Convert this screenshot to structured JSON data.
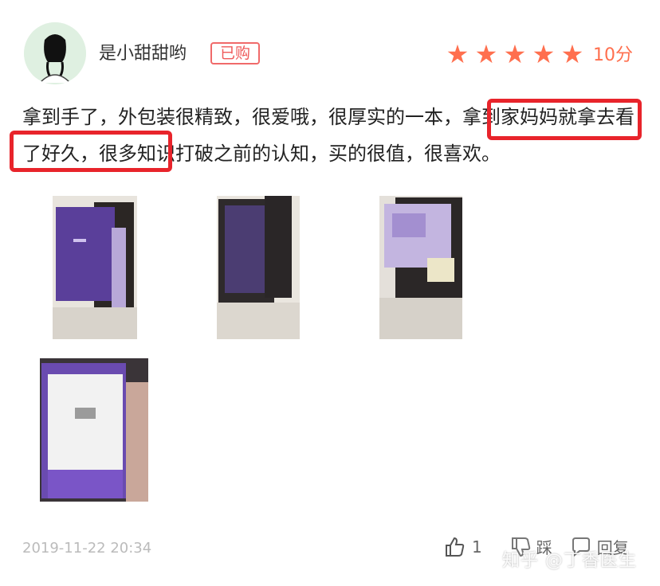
{
  "user": {
    "name": "是小甜甜哟",
    "badge": "已购"
  },
  "rating": {
    "stars": 5,
    "score_text": "10分",
    "color": "#ff6f4e"
  },
  "review": {
    "part1": "拿到手了，外包装很精致，很爱哦，很厚实的一本，",
    "highlight1": "拿到家妈妈就",
    "highlight2": "拿去看了好久，",
    "part2": "很多知识打破之前的认知，买的很值，很喜欢。",
    "highlight_color": "#e8242b"
  },
  "photos": [
    {
      "label": "box-photo-1"
    },
    {
      "label": "box-photo-2"
    },
    {
      "label": "box-photo-3"
    },
    {
      "label": "book-photo-4"
    }
  ],
  "footer": {
    "date": "2019-11-22 20:34",
    "like_count": "1",
    "dislike_label": "踩",
    "reply_label": "回复"
  },
  "watermark": "知乎 @丁香医生",
  "icons": {
    "like": "thumbs-up-icon",
    "dislike": "thumbs-down-icon",
    "reply": "comment-icon"
  }
}
